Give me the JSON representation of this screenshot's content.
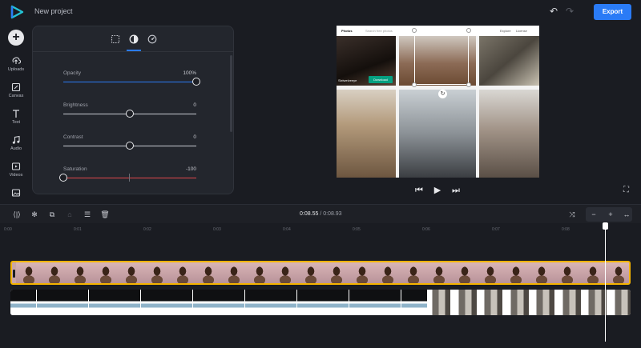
{
  "app": {
    "project_title": "New project",
    "export_label": "Export"
  },
  "sidebar": {
    "items": [
      {
        "label": "Uploads",
        "icon": "upload-icon"
      },
      {
        "label": "Canvas",
        "icon": "canvas-icon"
      },
      {
        "label": "Text",
        "icon": "text-icon"
      },
      {
        "label": "Audio",
        "icon": "audio-icon"
      },
      {
        "label": "Videos",
        "icon": "video-icon"
      },
      {
        "label": "",
        "icon": "image-icon"
      }
    ]
  },
  "panel": {
    "tabs": [
      "transform-icon",
      "color-adjust-icon",
      "speed-icon"
    ],
    "active_tab": 1,
    "properties": [
      {
        "label": "Opacity",
        "value": "100%",
        "fraction": 1.0,
        "accent": "#2a7bf6"
      },
      {
        "label": "Brightness",
        "value": "0",
        "fraction": 0.5,
        "accent": ""
      },
      {
        "label": "Contrast",
        "value": "0",
        "fraction": 0.5,
        "accent": ""
      },
      {
        "label": "Saturation",
        "value": "-100",
        "fraction": 0.0,
        "accent": "#e0484b"
      }
    ]
  },
  "preview": {
    "brand": "Photos",
    "search_placeholder": "Search free photos",
    "nav_links": [
      "Explore",
      "License"
    ],
    "author": "Sixtwelveeye",
    "download_label": "Download"
  },
  "timeline": {
    "current_time": "0:08.55",
    "separator": "/",
    "total_time": "0:08.93",
    "ruler": [
      "0:00",
      "0:01",
      "0:02",
      "0:03",
      "0:04",
      "0:05",
      "0:06",
      "0:07",
      "0:08"
    ],
    "tools": [
      "split-icon",
      "freeze-icon",
      "duplicate-icon",
      "clear-icon",
      "layout-icon",
      "delete-icon"
    ],
    "zoom_controls": [
      "fit-icon",
      "zoom-out-icon",
      "zoom-in-icon",
      "expand-icon"
    ]
  },
  "colors": {
    "accent": "#2a7bf6",
    "clip_border": "#f5b400",
    "background": "#1a1c22",
    "saturation": "#e0484b"
  }
}
